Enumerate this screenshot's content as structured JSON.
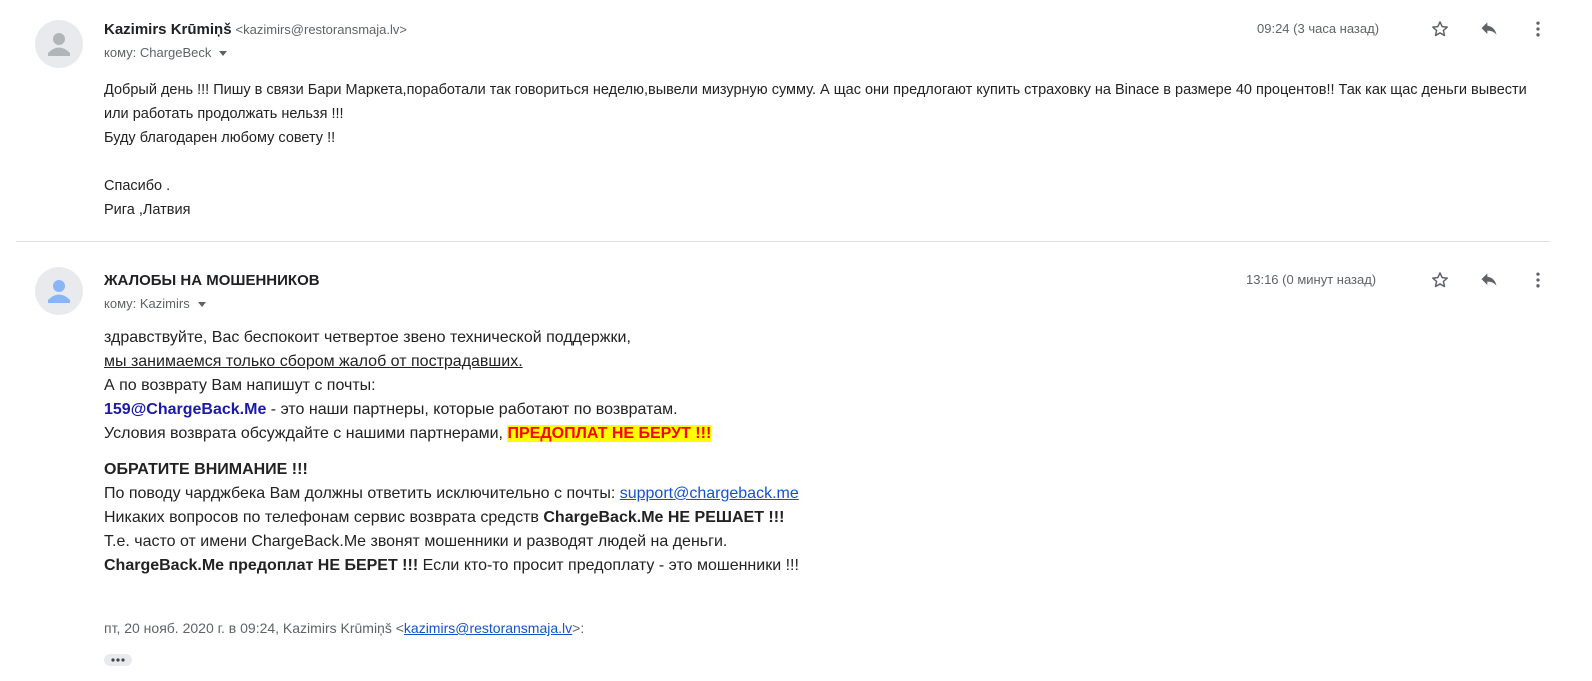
{
  "messages": [
    {
      "sender_name": "Kazimirs Krūmiņš",
      "sender_email": "<kazimirs@restoransmaja.lv>",
      "recipient": "кому: ChargeBeck",
      "time": "09:24 (3 часа назад)",
      "body": [
        "Добрый день !!! Пишу в связи Бари Маркета,поработали так говориться неделю,вывели мизурную сумму. А щас они предлогают купить страховку на Binace в размере 40 процентов!! Так как щас деньги вывести или работать продолжать нельзя !!!",
        "Буду благодарен любому совету !!",
        "",
        "Спасибо .",
        "Рига ,Латвия"
      ]
    },
    {
      "sender_name": "ЖАЛОБЫ НА МОШЕННИКОВ",
      "recipient": "кому: Kazimirs",
      "time": "13:16 (0 минут назад)",
      "body": {
        "l1": "здравствуйте, Вас беспокоит четвертое звено технической поддержки,",
        "l2": "мы занимаемся только сбором жалоб от пострадавших.",
        "l3": "А по возврату Вам напишут с почты:",
        "l4_email": "159@ChargeBack.Me",
        "l4_rest": " - это наши партнеры, которые работают по возвратам.",
        "l5_pre": "Условия возврата обсуждайте с нашими партнерами, ",
        "l5_highlight": "ПРЕДОПЛАТ НЕ БЕРУТ !!!",
        "l6": "ОБРАТИТЕ ВНИМАНИЕ !!!",
        "l7_pre": "По поводу чарджбека Вам должны ответить исключительно с почты: ",
        "l7_link": "support@chargeback.me",
        "l8_pre": "Никаких вопросов по телефонам сервис возврата средств ",
        "l8_bold": "ChargeBack.Me НЕ РЕШАЕТ !!!",
        "l9": "Т.е. часто от имени ChargeBack.Me звонят мошенники и разводят людей на деньги.",
        "l10_bold": "ChargeBack.Me предоплат НЕ БЕРЕТ !!!",
        "l10_rest": " Если кто-то просит предоплату - это мошенники !!!"
      },
      "quote_pre": "пт, 20 нояб. 2020 г. в 09:24, Kazimirs Krūmiņš <",
      "quote_link": "kazimirs@restoransmaja.lv",
      "quote_post": ">:"
    }
  ],
  "icons": {
    "avatar": "person-icon",
    "star": "star-icon",
    "reply": "reply-icon",
    "more": "more-vert-icon",
    "expand": "ellipsis-icon"
  },
  "colors": {
    "link": "#1155cc",
    "highlight_bg": "#ffff00",
    "highlight_text": "#ff0000",
    "email_blue": "#1a1aa6"
  }
}
